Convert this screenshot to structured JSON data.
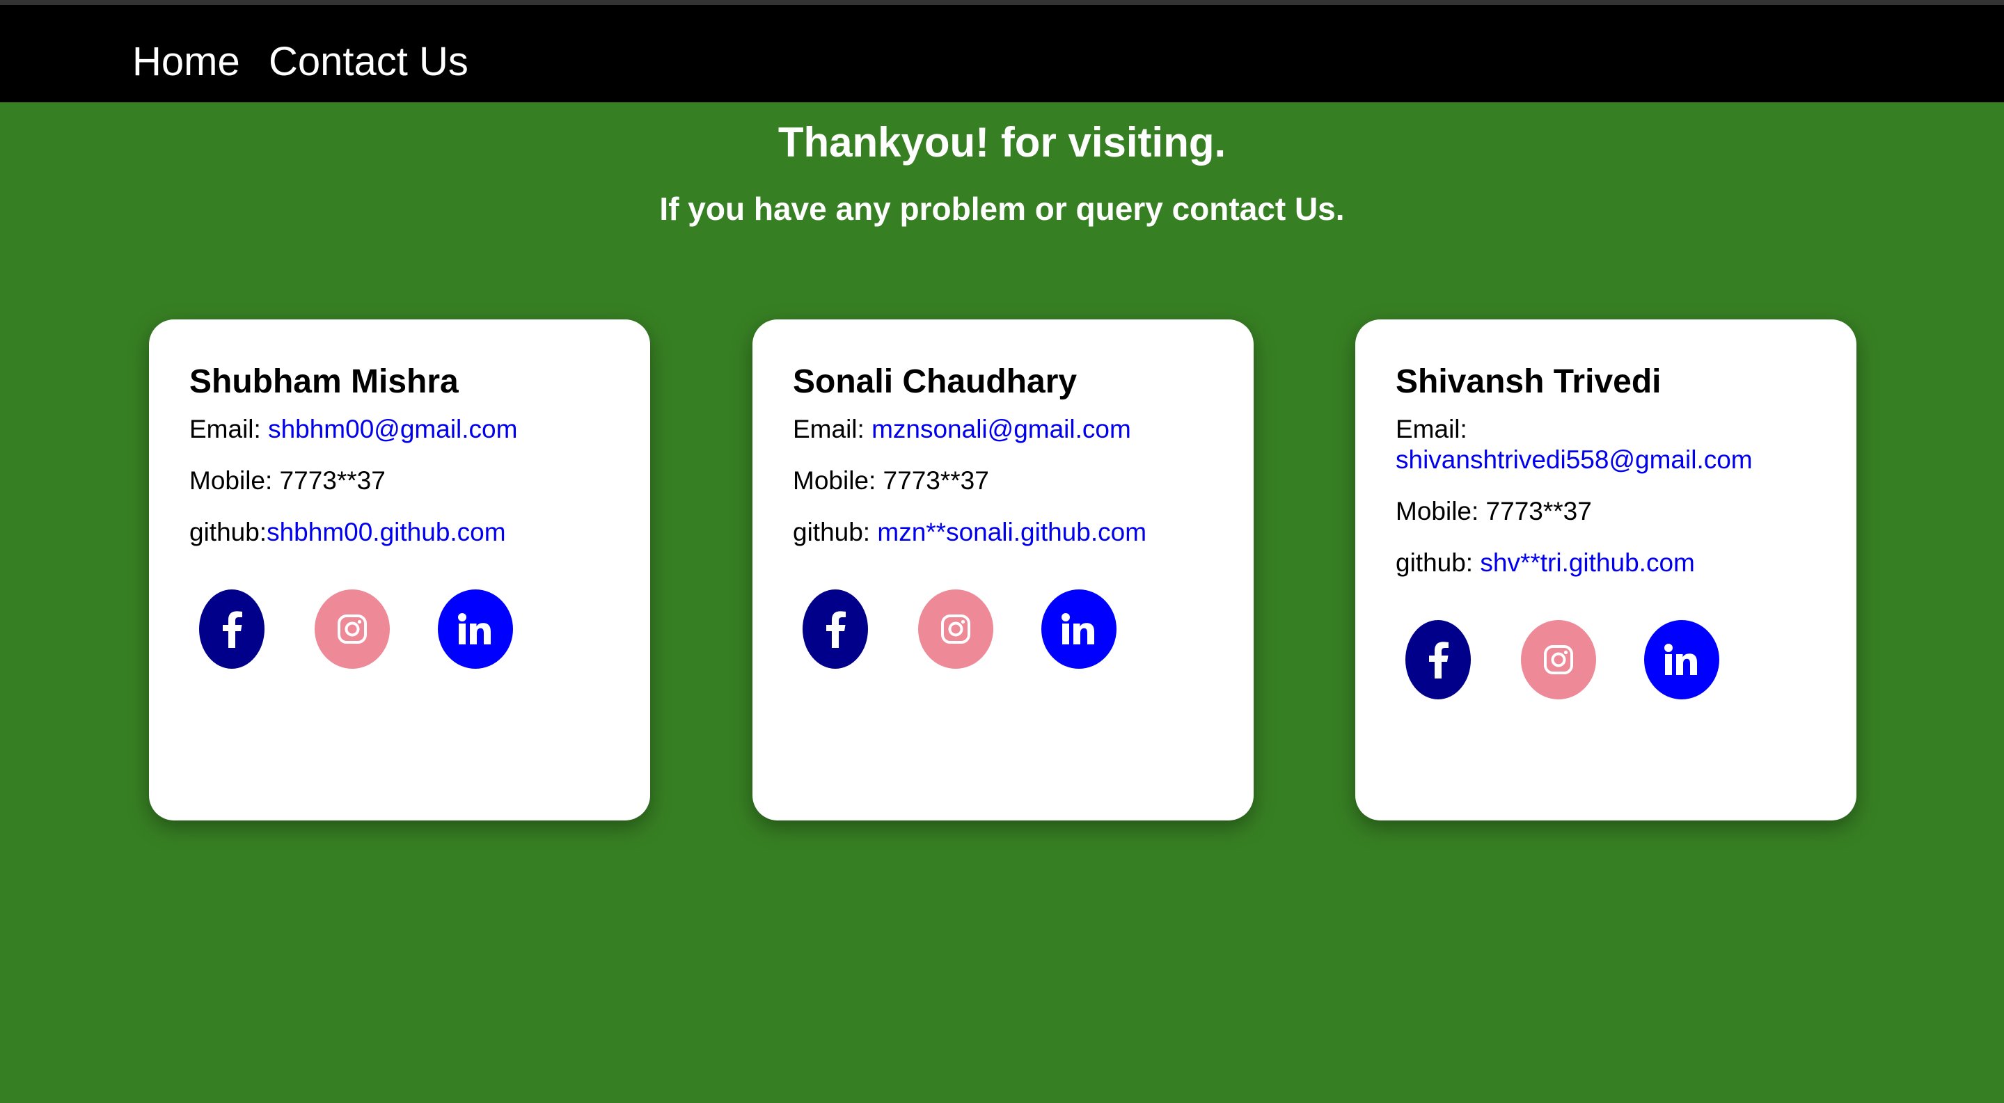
{
  "nav": {
    "home_label": "Home",
    "contact_label": "Contact Us"
  },
  "header": {
    "title": "Thankyou! for visiting.",
    "subtitle": "If you have any problem or query contact Us."
  },
  "cards": [
    {
      "name": "Shubham Mishra",
      "email_label": "Email: ",
      "email": "shbhm00@gmail.com",
      "mobile": "Mobile: 7773**37",
      "github_label": "github:",
      "github": "shbhm00.github.com"
    },
    {
      "name": "Sonali Chaudhary",
      "email_label": "Email: ",
      "email": "mznsonali@gmail.com",
      "mobile": "Mobile: 7773**37",
      "github_label": "github: ",
      "github": "mzn**sonali.github.com"
    },
    {
      "name": "Shivansh Trivedi",
      "email_label": "Email:",
      "email": "shivanshtrivedi558@gmail.com",
      "mobile": "Mobile: 7773**37",
      "github_label": "github: ",
      "github": "shv**tri.github.com"
    }
  ],
  "socials": {
    "facebook_icon": "facebook-icon",
    "instagram_icon": "instagram-icon",
    "linkedin_icon": "linkedin-icon"
  },
  "colors": {
    "page_background": "#377f23",
    "navbar_background": "#000000",
    "link": "#0000ee",
    "facebook": "#00008b",
    "instagram": "#ee8a97",
    "linkedin": "#0000ff"
  }
}
